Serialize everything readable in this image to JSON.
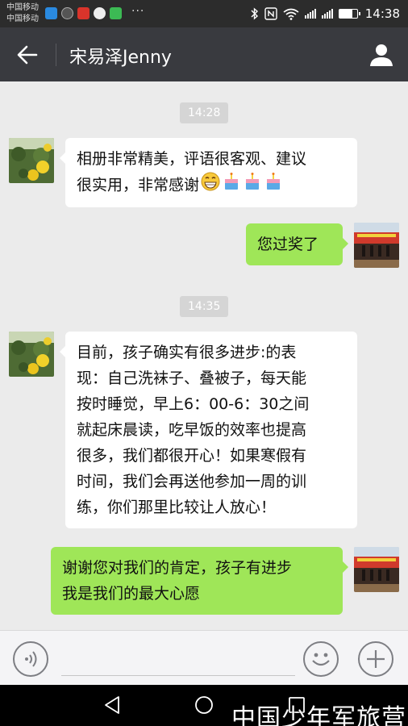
{
  "status_bar": {
    "carrier_1": "中国移动",
    "carrier_2": "中国移动",
    "time": "14:38",
    "icons": [
      "telegram-icon",
      "app-icon",
      "weibo-icon",
      "chat-bubble-icon",
      "play-store-icon",
      "more-dots-icon",
      "bluetooth-icon",
      "nfc-icon",
      "wifi-icon",
      "signal-icon",
      "signal-icon",
      "battery-icon"
    ],
    "more": "···",
    "battery_level": 0.75
  },
  "header": {
    "title": "宋易泽Jenny",
    "back_icon": "arrow-left-icon",
    "profile_icon": "person-icon"
  },
  "messages": [
    {
      "type": "time",
      "text": "14:28"
    },
    {
      "type": "incoming",
      "lines": [
        "相册非常精美，评语很客观、建议",
        "很实用，非常感谢"
      ],
      "emojis": [
        "grin-emoji",
        "cake-emoji",
        "cake-emoji",
        "cake-emoji"
      ]
    },
    {
      "type": "outgoing",
      "lines": [
        "您过奖了"
      ]
    },
    {
      "type": "time",
      "text": "14:35"
    },
    {
      "type": "incoming",
      "lines": [
        "目前，孩子确实有很多进步:的表",
        "现：自己洗袜子、叠被子，每天能",
        "按时睡觉，早上6：00-6：30之间",
        "就起床晨读，吃早饭的效率也提高",
        "很多，我们都很开心！如果寒假有",
        "时间，我们会再送他参加一周的训",
        "练，你们那里比较让人放心！"
      ]
    },
    {
      "type": "outgoing",
      "lines": [
        "谢谢您对我们的肯定，孩子有进步",
        "我是我们的最大心愿"
      ]
    }
  ],
  "input_bar": {
    "voice_icon": "voice-icon",
    "emoji_icon": "smiley-icon",
    "plus_icon": "plus-icon",
    "text_value": ""
  },
  "nav_bar": {
    "watermark": "中国少年军旅营"
  }
}
